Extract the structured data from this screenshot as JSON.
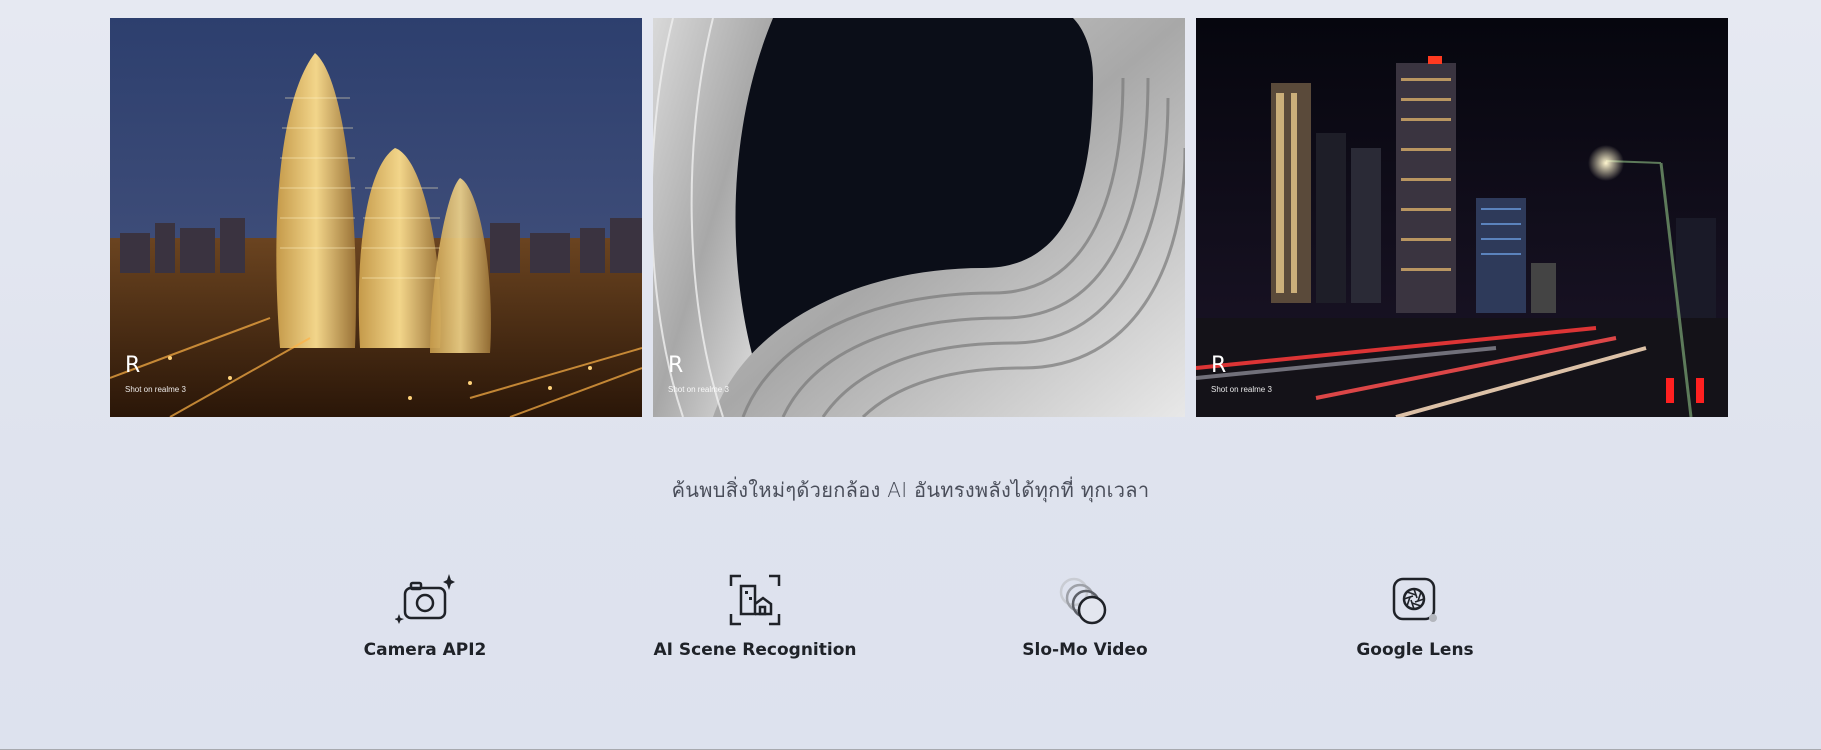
{
  "gallery": {
    "photos": [
      {
        "watermark_logo": "R",
        "watermark_text": "Shot on realme 3"
      },
      {
        "watermark_logo": "R",
        "watermark_text": "Shot on realme 3"
      },
      {
        "watermark_logo": "R",
        "watermark_text": "Shot on realme 3"
      }
    ]
  },
  "tagline": "ค้นพบสิ่งใหม่ๆด้วยกล้อง AI อันทรงพลังได้ทุกที่ ทุกเวลา",
  "features": [
    {
      "label": "Camera API2",
      "icon": "camera-sparkle-icon"
    },
    {
      "label": "AI Scene Recognition",
      "icon": "scene-recognition-icon"
    },
    {
      "label": "Slo-Mo Video",
      "icon": "slow-motion-circles-icon"
    },
    {
      "label": "Google Lens",
      "icon": "google-lens-icon"
    }
  ]
}
